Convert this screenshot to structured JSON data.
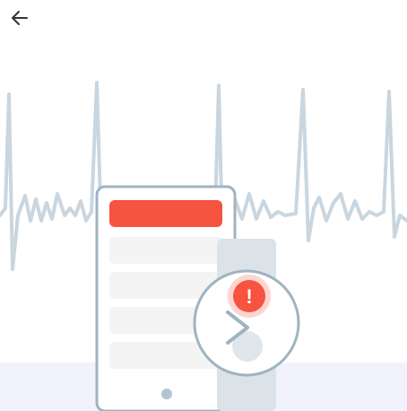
{
  "header": {
    "back_icon": "arrow-left-icon"
  },
  "illustration": {
    "description_icons": [
      "ecg-waveform-icon",
      "phone-icon",
      "smartwatch-icon",
      "alert-icon",
      "chevron-right-icon"
    ],
    "alert_glyph": "!",
    "colors": {
      "waveform": "#c9d6df",
      "device_outline": "#9fb4c1",
      "device_fill": "#ffffff",
      "phone_banner": "#f65340",
      "list_rows": "#f4f4f5",
      "alert": "#f65340",
      "watch_band": "#dbe3e9",
      "floor": "#f1f2fb"
    }
  }
}
